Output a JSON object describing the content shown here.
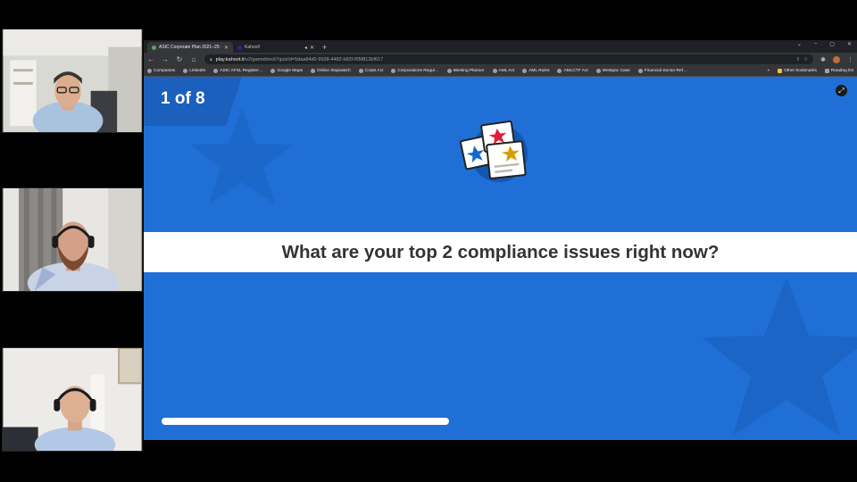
{
  "browser": {
    "tabs": [
      {
        "title": "ASIC Corporate Plan 2021–25: 1…",
        "active": true,
        "favicon_color": "#4caf50"
      },
      {
        "title": "Kahoot!",
        "active": false,
        "favicon_color": "#46178f"
      }
    ],
    "new_tab_glyph": "+",
    "window_controls": {
      "min": "–",
      "max": "▢",
      "close": "✕"
    },
    "address": {
      "host": "play.kahoot.it",
      "path": "/v2/gameblock?quizId=5daa84d0-9938-4482-b82f-f05f812bf617"
    },
    "bookmarks": [
      "Companies",
      "LinkedIn",
      "ASIC AFSL Register…",
      "Google Maps",
      "Online Stopwatch",
      "Corps Act",
      "Corporations Regul…",
      "Meeting Planner",
      "AML Act",
      "AML Rules",
      "AMLCTF Act",
      "Westpac Case",
      "Financial Sector Ref…"
    ],
    "bookmarks_overflow": "»",
    "other_bookmarks": "Other bookmarks",
    "reading_list": "Reading list"
  },
  "kahoot": {
    "counter": "1 of 8",
    "question": "What are your top 2 compliance issues right now?",
    "timer_progress": 0.4,
    "colors": {
      "background": "#1f6fd6",
      "bar": "#ffffff",
      "star_red": "#e21b3c",
      "star_blue": "#1368ce",
      "star_yellow": "#d89e00"
    }
  },
  "participants": [
    {
      "id": "participant-1"
    },
    {
      "id": "participant-2"
    },
    {
      "id": "participant-3"
    }
  ]
}
